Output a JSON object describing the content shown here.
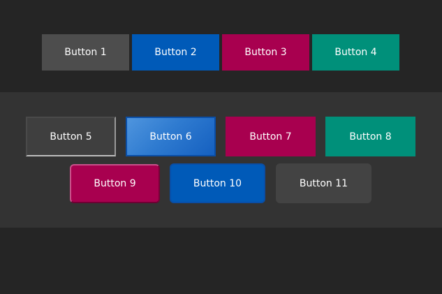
{
  "row1": {
    "buttons": [
      {
        "label": "Button 1",
        "color": "#4d4d4d"
      },
      {
        "label": "Button 2",
        "color": "#005ab8"
      },
      {
        "label": "Button 3",
        "color": "#a8004f"
      },
      {
        "label": "Button 4",
        "color": "#00907a"
      }
    ]
  },
  "panel": {
    "background": "#333333",
    "buttons": [
      {
        "label": "Button 5",
        "color": "#3f3f3f",
        "style": "outlined-gradient-border"
      },
      {
        "label": "Button 6",
        "color": "#2f7bd0",
        "style": "blue-gradient-glossy"
      },
      {
        "label": "Button 7",
        "color": "#a8004f"
      },
      {
        "label": "Button 8",
        "color": "#00907a"
      },
      {
        "label": "Button 9",
        "color": "#a8004f",
        "style": "rounded-bevel"
      },
      {
        "label": "Button 10",
        "color": "#005ab8",
        "style": "rounded"
      },
      {
        "label": "Button 11",
        "color": "#434343",
        "style": "rounded"
      }
    ]
  },
  "colors": {
    "page_background": "#252525",
    "panel_background": "#333333",
    "text": "#ffffff"
  }
}
